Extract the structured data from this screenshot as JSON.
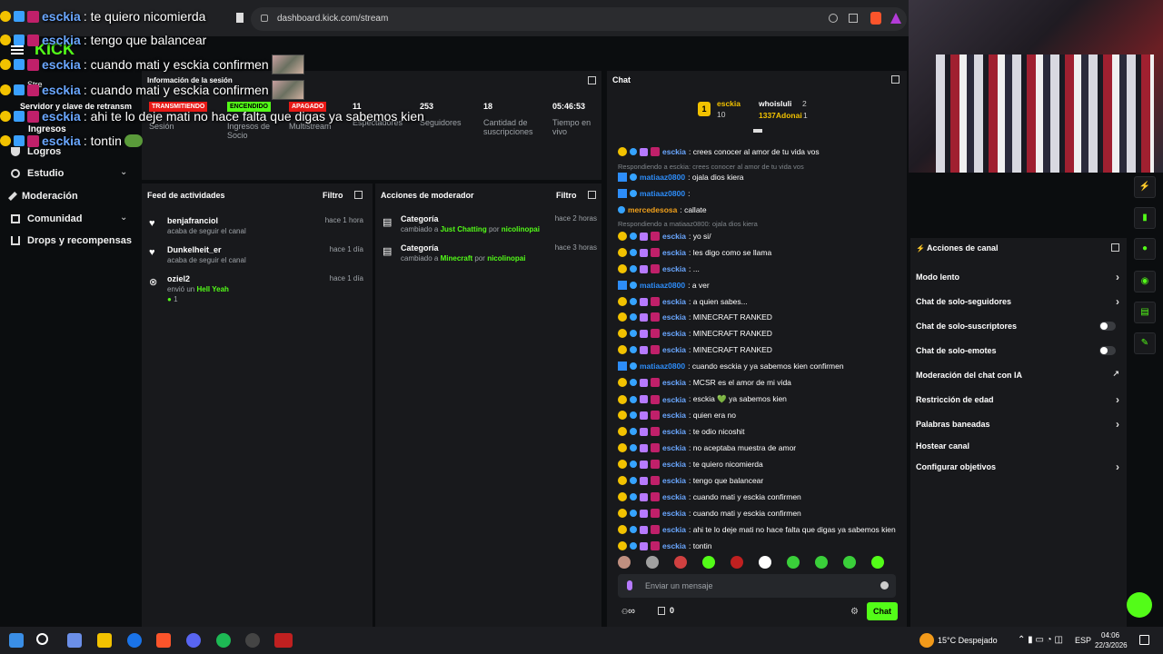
{
  "browser": {
    "url": "dashboard.kick.com/stream"
  },
  "overlay": {
    "lines": [
      {
        "user": "esckia",
        "text": ": te quiero nicomierda"
      },
      {
        "user": "esckia",
        "text": ": tengo que balancear"
      },
      {
        "user": "esckia",
        "text": ": cuando mati y esckia confirmen"
      },
      {
        "user": "esckia",
        "text": ": cuando mati y esckia confirmen"
      },
      {
        "user": "esckia",
        "text": ": ahi te lo deje mati no hace falta que digas ya sabemos kien"
      },
      {
        "user": "esckia",
        "text": ": tontin"
      }
    ],
    "logo": "KICK",
    "partial_labels": [
      "Stre",
      "Servidor y clave de retransm",
      "Ingresos"
    ]
  },
  "sidebar": {
    "items": [
      {
        "label": "Logros",
        "icon": "trophy-icon"
      },
      {
        "label": "Estudio",
        "icon": "studio-icon"
      },
      {
        "label": "Moderación",
        "icon": "wrench-icon"
      },
      {
        "label": "Comunidad",
        "icon": "community-icon"
      },
      {
        "label": "Drops y recompensas",
        "icon": "drops-icon"
      }
    ]
  },
  "session": {
    "title": "Información de la sesión",
    "badges": {
      "live": "TRANSMITIENDO",
      "on": "ENCENDIDO",
      "off": "APAGADO"
    },
    "stats": [
      {
        "value": "",
        "label": "Sesión"
      },
      {
        "value": "",
        "label": "Ingresos de Socio"
      },
      {
        "value": "",
        "label": "Multistream"
      },
      {
        "value": "11",
        "label": "Espectadores"
      },
      {
        "value": "253",
        "label": "Seguidores"
      },
      {
        "value": "18",
        "label": "Cantidad de suscripciones"
      },
      {
        "value": "05:46:53",
        "label": "Tiempo en vivo"
      }
    ]
  },
  "feed": {
    "title": "Feed de actividades",
    "filter": "Filtro",
    "items": [
      {
        "name": "benjafranciol",
        "sub": "acaba de seguir el canal",
        "time": "hace 1 hora",
        "icon": "heart-icon"
      },
      {
        "name": "Dunkelheit_er",
        "sub": "acaba de seguir el canal",
        "time": "hace 1 día",
        "icon": "heart-icon"
      },
      {
        "name": "oziel2",
        "sub_prefix": "envió un",
        "sub_highlight": "Hell Yeah",
        "count": "1",
        "time": "hace 1 día",
        "icon": "gift-icon"
      }
    ]
  },
  "moderator": {
    "title": "Acciones de moderador",
    "filter": "Filtro",
    "items": [
      {
        "title": "Categoría",
        "prefix": "cambiado a",
        "value": "Just Chatting",
        "por": "por",
        "user": "nicolinopai",
        "time": "hace 2 horas"
      },
      {
        "title": "Categoría",
        "prefix": "cambiado a",
        "value": "Minecraft",
        "por": "por",
        "user": "nicolinopai",
        "time": "hace 3 horas"
      }
    ]
  },
  "chat": {
    "title": "Chat",
    "top": {
      "rank": "1",
      "user1": "esckia",
      "count1": "10",
      "user2": "whoisluli",
      "count2": "2",
      "user3": "1337Adonai",
      "count3": "1"
    },
    "messages": [
      {
        "kind": "sub",
        "user": "esckia",
        "text": ": crees conocer al amor de tu vida vos"
      },
      {
        "kind": "reply",
        "text": "Respondiendo a esckia: crees conocer al amor de tu vida vos"
      },
      {
        "kind": "mod",
        "user": "matiaaz0800",
        "text": ": ojala dios kiera"
      },
      {
        "kind": "mod",
        "user": "matiaaz0800",
        "text": ":"
      },
      {
        "kind": "plain",
        "user": "mercedesosa",
        "text": ": callate"
      },
      {
        "kind": "reply",
        "text": "Respondiendo a matiaaz0800: ojala dios kiera"
      },
      {
        "kind": "sub",
        "user": "esckia",
        "text": ": yo si/"
      },
      {
        "kind": "sub",
        "user": "esckia",
        "text": ": les digo como se llama"
      },
      {
        "kind": "sub",
        "user": "esckia",
        "text": ": ..."
      },
      {
        "kind": "mod",
        "user": "matiaaz0800",
        "text": ": a ver"
      },
      {
        "kind": "sub",
        "user": "esckia",
        "text": ": a quien sabes..."
      },
      {
        "kind": "sub",
        "user": "esckia",
        "text": ": MINECRAFT RANKED"
      },
      {
        "kind": "sub",
        "user": "esckia",
        "text": ": MINECRAFT RANKED"
      },
      {
        "kind": "sub",
        "user": "esckia",
        "text": ": MINECRAFT RANKED"
      },
      {
        "kind": "mod",
        "user": "matiaaz0800",
        "text": ": cuando esckia y ya sabemos kien confirmen"
      },
      {
        "kind": "sub",
        "user": "esckia",
        "text": ": MCSR es el amor de mi vida"
      },
      {
        "kind": "sub",
        "user": "esckia",
        "text": ": esckia 💚 ya sabemos kien"
      },
      {
        "kind": "sub",
        "user": "esckia",
        "text": ": quien era no"
      },
      {
        "kind": "sub",
        "user": "esckia",
        "text": ": te odio nicoshit"
      },
      {
        "kind": "sub",
        "user": "esckia",
        "text": ": no aceptaba muestra de amor"
      },
      {
        "kind": "sub",
        "user": "esckia",
        "text": ": te quiero nicomierda"
      },
      {
        "kind": "sub",
        "user": "esckia",
        "text": ": tengo que balancear"
      },
      {
        "kind": "sub",
        "user": "esckia",
        "text": ": cuando mati y esckia confirmen"
      },
      {
        "kind": "sub",
        "user": "esckia",
        "text": ": cuando mati y esckia confirmen"
      },
      {
        "kind": "sub",
        "user": "esckia",
        "text": ": ahi te lo deje mati no hace falta que digas ya sabemos kien"
      },
      {
        "kind": "sub",
        "user": "esckia",
        "text": ": tontin"
      }
    ],
    "input_placeholder": "Enviar un mensaje",
    "infinite": "∞",
    "count": "0",
    "send": "Chat"
  },
  "channel_actions": {
    "title": "Acciones de canal",
    "items": [
      {
        "label": "Modo lento",
        "control": "chevron"
      },
      {
        "label": "Chat de solo-seguidores",
        "control": "chevron"
      },
      {
        "label": "Chat de solo-suscriptores",
        "control": "toggle"
      },
      {
        "label": "Chat de solo-emotes",
        "control": "toggle"
      },
      {
        "label": "Moderación del chat con IA",
        "control": "external"
      },
      {
        "label": "Restricción de edad",
        "control": "chevron"
      },
      {
        "label": "Palabras baneadas",
        "control": "chevron"
      },
      {
        "label": "Hostear canal",
        "control": "none"
      },
      {
        "label": "Configurar objetivos",
        "control": "chevron"
      }
    ]
  },
  "taskbar": {
    "weather": "15°C  Despejado",
    "lang": "ESP",
    "time": "04:06",
    "date": "22/3/2026"
  },
  "colors": {
    "accent": "#53fc18",
    "bg": "#0b0d0f",
    "panel": "#18191c",
    "live": "#e91916"
  }
}
